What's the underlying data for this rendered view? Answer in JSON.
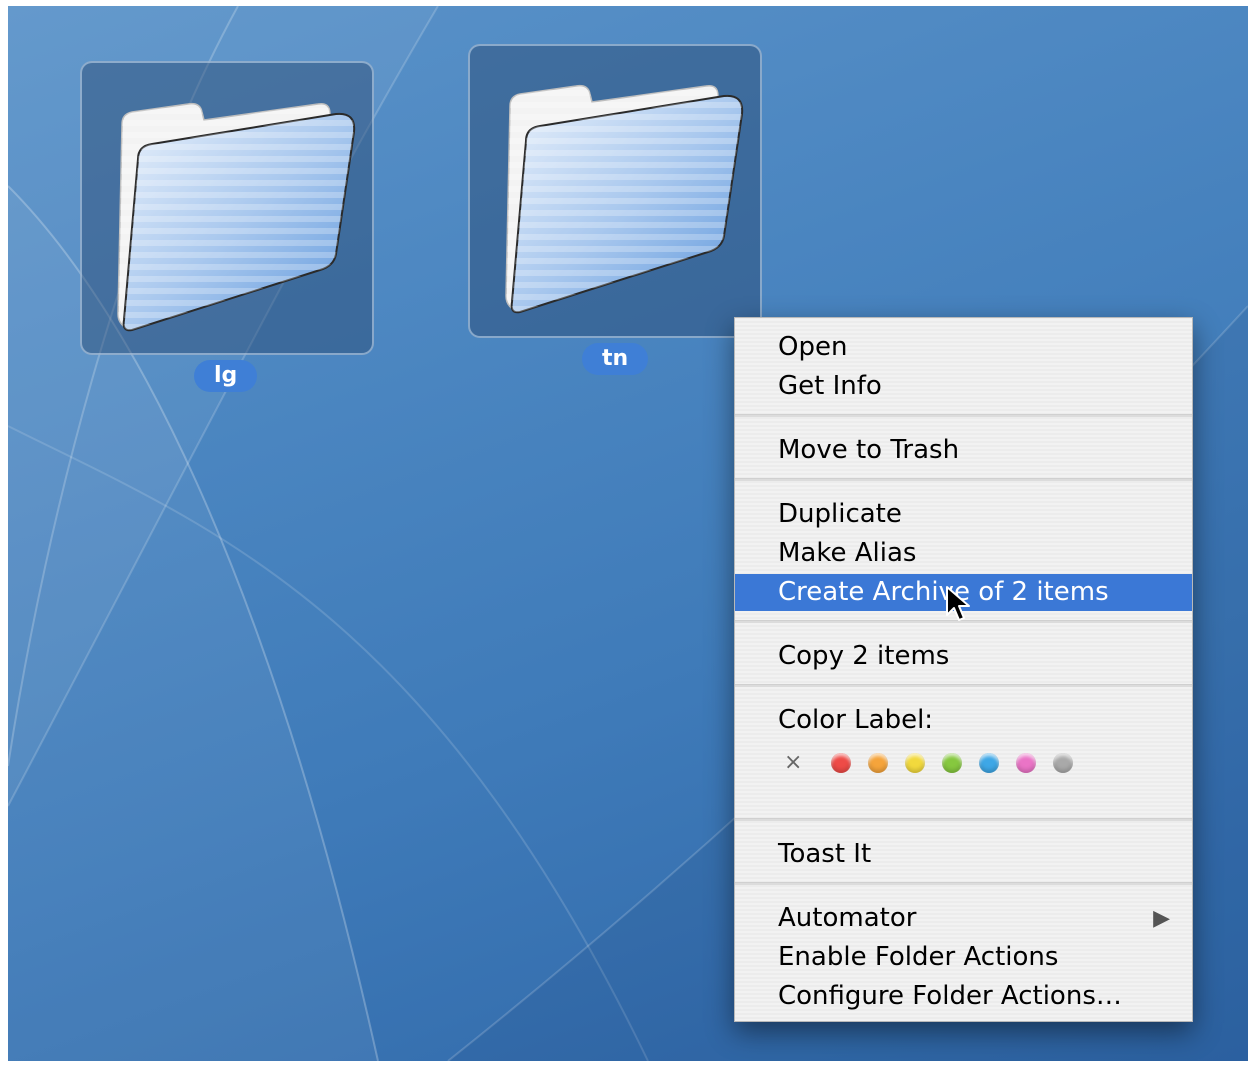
{
  "desktop": {
    "folders": [
      {
        "label": "lg"
      },
      {
        "label": "tn"
      }
    ]
  },
  "context_menu": {
    "groups": [
      {
        "items": [
          "Open",
          "Get Info"
        ]
      },
      {
        "items": [
          "Move to Trash"
        ]
      },
      {
        "items": [
          "Duplicate",
          "Make Alias",
          "Create Archive of 2 items"
        ]
      },
      {
        "items": [
          "Copy 2 items"
        ]
      },
      {
        "items": [
          "Color Label:"
        ]
      },
      {
        "items": [
          "Toast It"
        ]
      },
      {
        "items": [
          "Automator",
          "Enable Folder Actions",
          "Configure Folder Actions…"
        ]
      }
    ],
    "highlighted_item": "Create Archive of 2 items",
    "submenu_item": "Automator",
    "color_labels": {
      "none_symbol": "×",
      "colors": [
        "#ee4b47",
        "#f5a43b",
        "#f2d93d",
        "#86c83f",
        "#3ea7e6",
        "#ea74c6",
        "#a9a9a9"
      ]
    }
  },
  "colors": {
    "desktop_blue": "#4a85c0",
    "selection_blue": "#3b78d6",
    "label_blue": "#3f7fd6"
  }
}
